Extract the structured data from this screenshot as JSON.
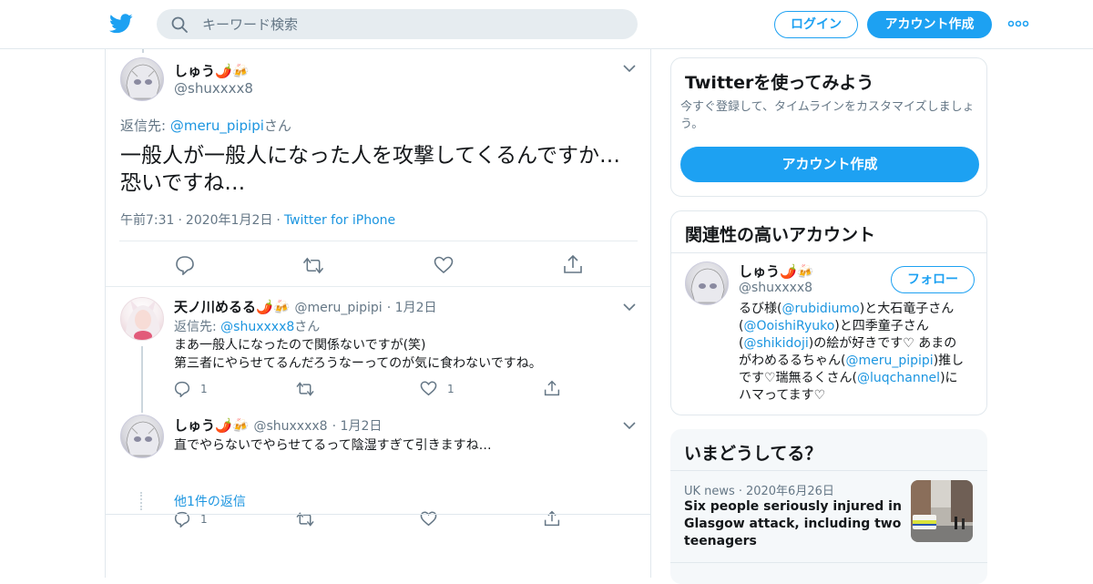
{
  "header": {
    "search_placeholder": "キーワード検索",
    "login_label": "ログイン",
    "signup_label": "アカウント作成"
  },
  "main_tweet": {
    "name": "しゅう🌶️🍻",
    "handle": "@shuxxxx8",
    "reply_prefix": "返信先: ",
    "reply_to": "@meru_pipipi",
    "reply_suffix": "さん",
    "text_line1": "一般人が一般人になった人を攻撃してくるんですか…",
    "text_line2": "恐いですね…",
    "time": "午前7:31",
    "date": "2020年1月2日",
    "source": "Twitter for iPhone"
  },
  "replies": [
    {
      "name": "天ノ川めるる🌶️🍻",
      "handle": "@meru_pipipi",
      "date": "1月2日",
      "reply_prefix": "返信先: ",
      "reply_to": "@shuxxxx8",
      "reply_suffix": "さん",
      "line1": "まあ一般人になったので関係ないですが(笑)",
      "line2": "第三者にやらせてるんだろうなーってのが気に食わないですね。",
      "reply_count": "1",
      "like_count": "1"
    },
    {
      "name": "しゅう🌶️🍻",
      "handle": "@shuxxxx8",
      "date": "1月2日",
      "line1": "直でやらないでやらせてるって陰湿すぎて引きますね…",
      "reply_count": "1"
    }
  ],
  "more_replies_label": "他1件の返信",
  "signup_card": {
    "title": "Twitterを使ってみよう",
    "desc": "今すぐ登録して、タイムラインをカスタマイズしましょう。",
    "button": "アカウント作成"
  },
  "related_card": {
    "title": "関連性の高いアカウント",
    "name": "しゅう🌶️🍻",
    "handle": "@shuxxxx8",
    "follow_label": "フォロー",
    "bio_1": "るび様(",
    "bio_link1": "@rubidiumo",
    "bio_2": ")と大石竜子さん",
    "bio_3": "(",
    "bio_link2": "@OoishiRyuko",
    "bio_4": ")と四季童子さん",
    "bio_5": "(",
    "bio_link3": "@shikidoji",
    "bio_6": ")の絵が好きです♡ あまの",
    "bio_7": "がわめるるちゃん(",
    "bio_link4": "@meru_pipipi",
    "bio_8": ")推し",
    "bio_9": "です♡瑞無るくさん(",
    "bio_link5": "@luqchannel",
    "bio_10": ")に",
    "bio_11": "ハマってます♡"
  },
  "trends_card": {
    "title": "いまどうしてる？",
    "category": "UK news",
    "date": "2020年6月26日",
    "headline_1": "Six people seriously injured in",
    "headline_2": "Glasgow attack, including two",
    "headline_3": "teenagers"
  },
  "colors": {
    "accent": "#1da1f2",
    "link": "#1b95e0",
    "muted": "#657786",
    "border": "#e1e8ed"
  }
}
